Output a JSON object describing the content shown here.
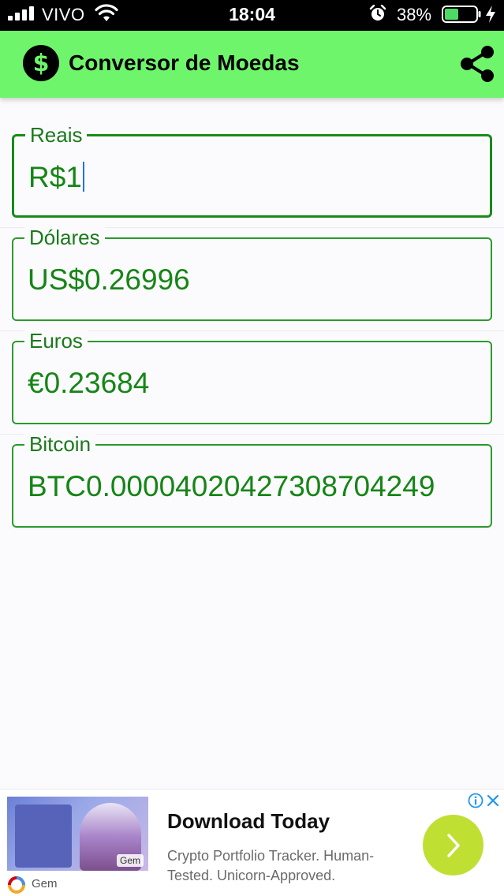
{
  "status_bar": {
    "carrier": "VIVO",
    "time": "18:04",
    "battery_percent": "38%",
    "signal_bars": 4,
    "icons": [
      "signal-icon",
      "wifi-icon",
      "alarm-icon",
      "battery-icon",
      "charging-icon"
    ]
  },
  "app_bar": {
    "title": "Conversor de Moedas",
    "icons": [
      "dollar-coin-icon",
      "share-icon"
    ],
    "background_color": "#6ff56b"
  },
  "fields": [
    {
      "label": "Reais",
      "value": "R$1",
      "focused": true
    },
    {
      "label": "Dólares",
      "value": "US$0.26996",
      "focused": false
    },
    {
      "label": "Euros",
      "value": "€0.23684",
      "focused": false
    },
    {
      "label": "Bitcoin",
      "value": "BTC0.000040204273087042​49",
      "focused": false
    }
  ],
  "ad": {
    "headline": "Download Today",
    "body": "Crypto Portfolio Tracker. Human-Tested. Unicorn-Approved.",
    "brand": "Gem",
    "image_tag": "Gem",
    "icons": [
      "ad-info-icon",
      "ad-close-icon",
      "chevron-right-icon",
      "gem-logo-icon"
    ],
    "cta_color": "#bfe032"
  },
  "colors": {
    "accent_green": "#168516",
    "border_green": "#2c9a2c"
  }
}
